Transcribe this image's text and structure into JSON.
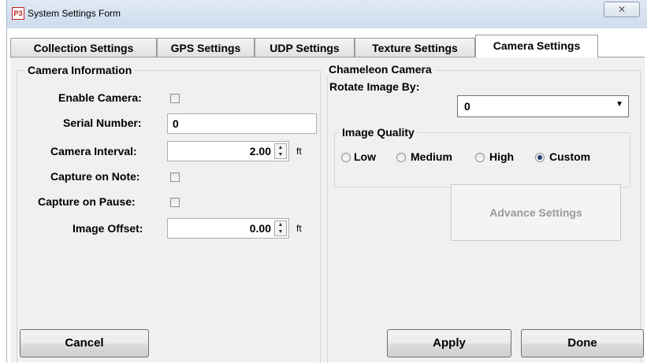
{
  "window": {
    "title": "System Settings Form",
    "icon_text": "P3",
    "close_glyph": "✕"
  },
  "tabs": [
    {
      "label": "Collection Settings",
      "active": false
    },
    {
      "label": "GPS Settings",
      "active": false
    },
    {
      "label": "UDP Settings",
      "active": false
    },
    {
      "label": "Texture Settings",
      "active": false
    },
    {
      "label": "Camera Settings",
      "active": true
    }
  ],
  "camera_info": {
    "title": "Camera Information",
    "enable_camera": {
      "label": "Enable Camera:",
      "checked": false
    },
    "serial_number": {
      "label": "Serial Number:",
      "value": "0"
    },
    "camera_interval": {
      "label": "Camera Interval:",
      "value": "2.00",
      "unit": "ft"
    },
    "capture_on_note": {
      "label": "Capture on Note:",
      "checked": false
    },
    "capture_on_pause": {
      "label": "Capture on Pause:",
      "checked": false
    },
    "image_offset": {
      "label": "Image Offset:",
      "value": "0.00",
      "unit": "ft"
    }
  },
  "chameleon": {
    "title": "Chameleon Camera",
    "rotate_label": "Rotate Image By:",
    "rotate_value": "0",
    "image_quality": {
      "title": "Image Quality",
      "options": [
        {
          "label": "Low",
          "checked": false
        },
        {
          "label": "Medium",
          "checked": false
        },
        {
          "label": "High",
          "checked": false
        },
        {
          "label": "Custom",
          "checked": true
        }
      ]
    },
    "advance_settings_label": "Advance Settings"
  },
  "buttons": {
    "cancel": "Cancel",
    "apply": "Apply",
    "done": "Done"
  },
  "colors": {
    "panel_bg": "#f0f0f0",
    "disabled_text": "#9a9a9a",
    "titlebar": "#dfe9f5"
  }
}
